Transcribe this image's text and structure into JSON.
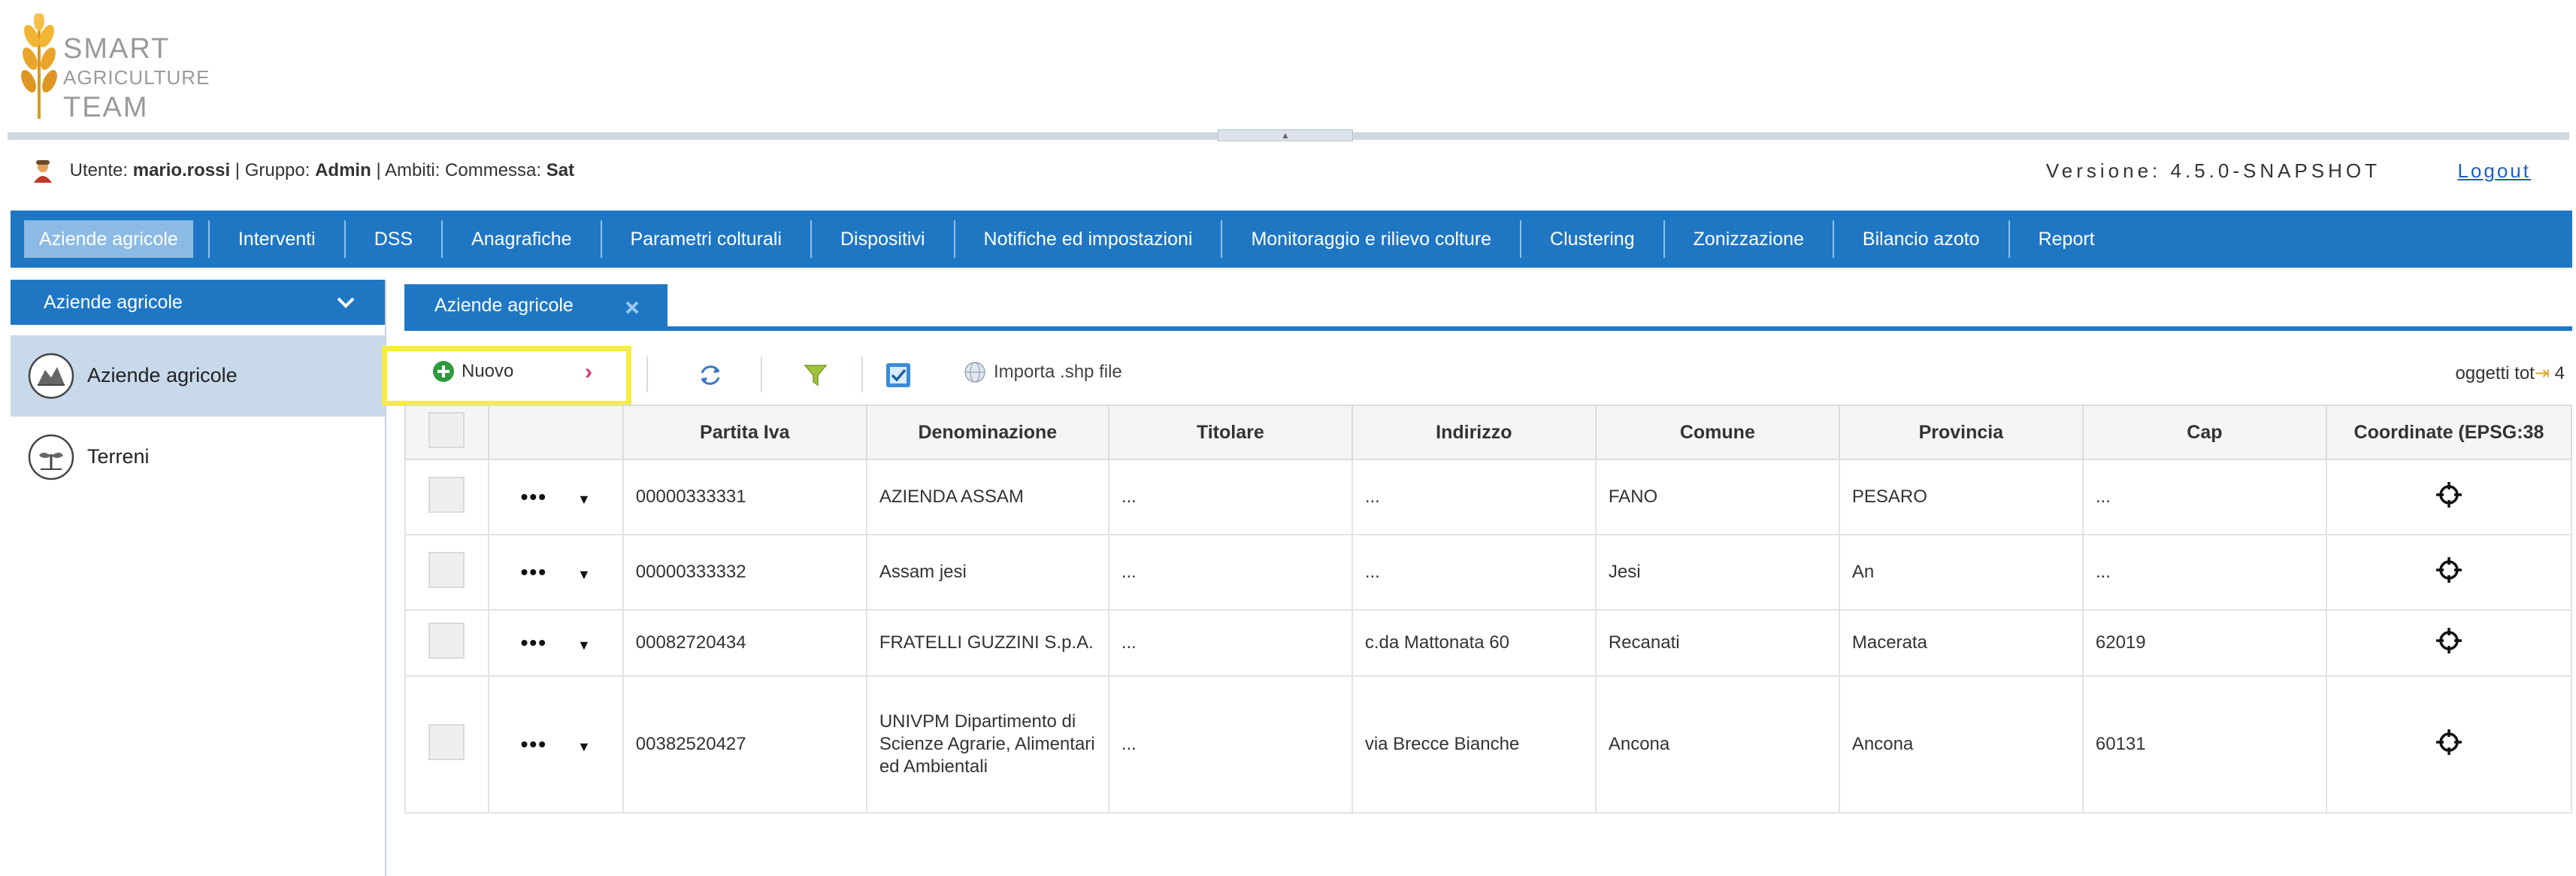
{
  "logo": {
    "line1": "SMART",
    "line2": "AGRICULTURE",
    "line3": "TEAM"
  },
  "userbar": {
    "user_label": "Utente:",
    "user_name": "mario.rossi",
    "group_label": "| Gruppo:",
    "group_name": "Admin",
    "scope_label": "| Ambiti: Commessa:",
    "scope_name": "Sat",
    "version": "Versione: 4.5.0-SNAPSHOT",
    "logout": "Logout"
  },
  "nav": [
    "Aziende agricole",
    "Interventi",
    "DSS",
    "Anagrafiche",
    "Parametri colturali",
    "Dispositivi",
    "Notifiche ed impostazioni",
    "Monitoraggio e rilievo colture",
    "Clustering",
    "Zonizzazione",
    "Bilancio azoto",
    "Report"
  ],
  "left_panel": {
    "header": "Aziende agricole",
    "items": [
      "Aziende agricole",
      "Terreni"
    ]
  },
  "tab": {
    "label": "Aziende agricole"
  },
  "toolbar": {
    "new_label": "Nuovo",
    "import_label": "Importa .shp file",
    "count_label": "oggetti tot",
    "count_value": "4"
  },
  "table": {
    "columns": [
      "Partita Iva",
      "Denominazione",
      "Titolare",
      "Indirizzo",
      "Comune",
      "Provincia",
      "Cap",
      "Coordinate (EPSG:38"
    ],
    "rows": [
      {
        "piva": "00000333331",
        "denominazione": "AZIENDA ASSAM",
        "titolare": "...",
        "indirizzo": "...",
        "comune": "FANO",
        "provincia": "PESARO",
        "cap": "..."
      },
      {
        "piva": "00000333332",
        "denominazione": "Assam jesi",
        "titolare": "...",
        "indirizzo": "...",
        "comune": "Jesi",
        "provincia": "An",
        "cap": "..."
      },
      {
        "piva": "00082720434",
        "denominazione": "FRATELLI GUZZINI S.p.A.",
        "titolare": "...",
        "indirizzo": "c.da Mattonata 60",
        "comune": "Recanati",
        "provincia": "Macerata",
        "cap": "62019"
      },
      {
        "piva": "00382520427",
        "denominazione": "UNIVPM Dipartimento di Scienze Agrarie, Alimentari ed Ambientali",
        "titolare": "...",
        "indirizzo": "via Brecce Bianche",
        "comune": "Ancona",
        "provincia": "Ancona",
        "cap": "60131"
      }
    ]
  },
  "colors": {
    "primary": "#1f77c4",
    "highlight": "#f6ed3e",
    "active_nav": "#8bbbe4",
    "selected_item": "#c7d9ea"
  }
}
